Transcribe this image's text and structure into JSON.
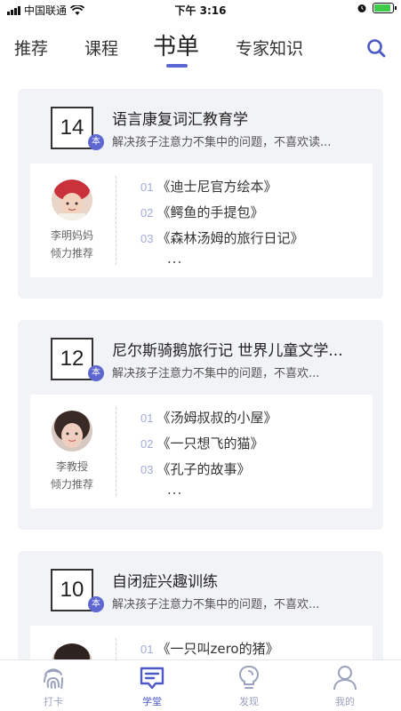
{
  "status_bar": {
    "carrier": "中国联通",
    "time": "下午 3:16"
  },
  "tabs": [
    {
      "label": "推荐",
      "active": false
    },
    {
      "label": "课程",
      "active": false
    },
    {
      "label": "书单",
      "active": true
    },
    {
      "label": "专家知识",
      "active": false
    }
  ],
  "accent_color": "#5865d3",
  "cards": [
    {
      "count": "14",
      "unit": "本",
      "title": "语言康复词汇教育学",
      "description": "解决孩子注意力不集中的问题，不喜欢读...",
      "recommender": "李明妈妈",
      "recommend_label": "倾力推荐",
      "books": [
        {
          "num": "01",
          "title": "《迪士尼官方绘本》"
        },
        {
          "num": "02",
          "title": "《鳄鱼的手提包》"
        },
        {
          "num": "03",
          "title": "《森林汤姆的旅行日记》"
        }
      ],
      "more": "..."
    },
    {
      "count": "12",
      "unit": "本",
      "title": "尼尔斯骑鹅旅行记 世界儿童文学...",
      "description": "解决孩子注意力不集中的问题，不喜欢...",
      "recommender": "李教授",
      "recommend_label": "倾力推荐",
      "books": [
        {
          "num": "01",
          "title": "《汤姆叔叔的小屋》"
        },
        {
          "num": "02",
          "title": "《一只想飞的猫》"
        },
        {
          "num": "03",
          "title": "《孔子的故事》"
        }
      ],
      "more": "..."
    },
    {
      "count": "10",
      "unit": "本",
      "title": "自闭症兴趣训练",
      "description": "解决孩子注意力不集中的问题，不喜欢...",
      "books": [
        {
          "num": "01",
          "title": "《一只叫zero的猪》"
        }
      ]
    }
  ],
  "bottom_nav": [
    {
      "label": "打卡",
      "icon": "fingerprint-icon",
      "active": false
    },
    {
      "label": "学堂",
      "icon": "chat-board-icon",
      "active": true
    },
    {
      "label": "发现",
      "icon": "bulb-icon",
      "active": false
    },
    {
      "label": "我的",
      "icon": "person-icon",
      "active": false
    }
  ]
}
